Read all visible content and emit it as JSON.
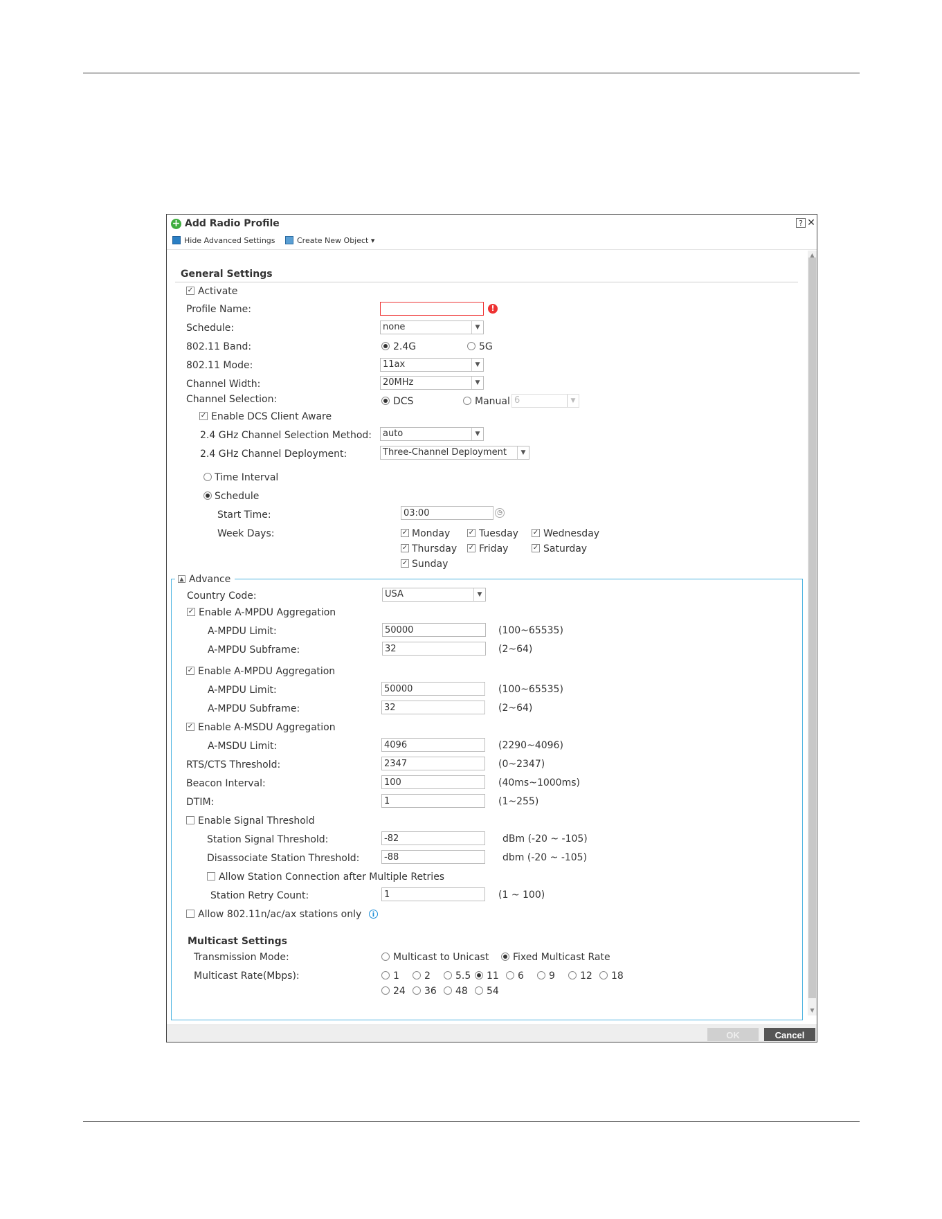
{
  "dialog": {
    "title": "Add Radio Profile",
    "help": "?",
    "close": "✕",
    "toolbar": {
      "hide_advanced": "Hide Advanced Settings",
      "create_object": "Create New Object ▾"
    },
    "ok_label": "OK",
    "cancel_label": "Cancel"
  },
  "general": {
    "heading": "General Settings",
    "activate": {
      "label": "Activate",
      "checked": true
    },
    "profile_name": {
      "label": "Profile Name:",
      "value": ""
    },
    "schedule": {
      "label": "Schedule:",
      "value": "none"
    },
    "band": {
      "label": "802.11 Band:",
      "opt1": "2.4G",
      "opt2": "5G",
      "selected": "2.4G"
    },
    "mode": {
      "label": "802.11 Mode:",
      "value": "11ax"
    },
    "channel_width": {
      "label": "Channel Width:",
      "value": "20MHz"
    },
    "channel_selection": {
      "label": "Channel Selection:",
      "opt1": "DCS",
      "opt2": "Manual",
      "manual_value": "6",
      "selected": "DCS"
    },
    "dcs_client_aware": {
      "label": "Enable DCS Client Aware",
      "checked": true
    },
    "selection_method": {
      "label": "2.4 GHz Channel Selection Method:",
      "value": "auto"
    },
    "deployment": {
      "label": "2.4 GHz Channel Deployment:",
      "value": "Three-Channel Deployment"
    },
    "time_interval": {
      "label": "Time Interval"
    },
    "schedule_radio": {
      "label": "Schedule"
    },
    "start_time": {
      "label": "Start Time:",
      "value": "03:00"
    },
    "week_days": {
      "label": "Week Days:",
      "days": [
        "Monday",
        "Tuesday",
        "Wednesday",
        "Thursday",
        "Friday",
        "Saturday",
        "Sunday"
      ]
    }
  },
  "advance": {
    "legend": "Advance",
    "country_code": {
      "label": "Country Code:",
      "value": "USA"
    },
    "ampdu1": {
      "label": "Enable A-MPDU Aggregation",
      "limit_label": "A-MPDU Limit:",
      "limit_value": "50000",
      "limit_range": "(100~65535)",
      "subframe_label": "A-MPDU Subframe:",
      "subframe_value": "32",
      "subframe_range": "(2~64)"
    },
    "ampdu2": {
      "label": "Enable A-MPDU Aggregation",
      "limit_label": "A-MPDU Limit:",
      "limit_value": "50000",
      "limit_range": "(100~65535)",
      "subframe_label": "A-MPDU Subframe:",
      "subframe_value": "32",
      "subframe_range": "(2~64)"
    },
    "amsdu": {
      "label": "Enable A-MSDU Aggregation",
      "limit_label": "A-MSDU Limit:",
      "limit_value": "4096",
      "limit_range": "(2290~4096)"
    },
    "rts": {
      "label": "RTS/CTS Threshold:",
      "value": "2347",
      "range": "(0~2347)"
    },
    "beacon": {
      "label": "Beacon Interval:",
      "value": "100",
      "range": "(40ms~1000ms)"
    },
    "dtim": {
      "label": "DTIM:",
      "value": "1",
      "range": "(1~255)"
    },
    "signal": {
      "label": "Enable Signal Threshold",
      "station_label": "Station Signal Threshold:",
      "station_value": "-82",
      "station_range": "dBm (-20 ~ -105)",
      "disassoc_label": "Disassociate Station Threshold:",
      "disassoc_value": "-88",
      "disassoc_range": "dbm (-20 ~ -105)",
      "allow_retries": "Allow Station Connection after Multiple Retries",
      "retry_label": "Station Retry Count:",
      "retry_value": "1",
      "retry_range": "(1 ~ 100)"
    },
    "allow_n_only": {
      "label": "Allow 802.11n/ac/ax stations only"
    },
    "multicast": {
      "heading": "Multicast Settings",
      "mode_label": "Transmission Mode:",
      "mode_opt1": "Multicast to Unicast",
      "mode_opt2": "Fixed Multicast Rate",
      "rate_label": "Multicast Rate(Mbps):",
      "rates": [
        "1",
        "2",
        "5.5",
        "11",
        "6",
        "9",
        "12",
        "18",
        "24",
        "36",
        "48",
        "54"
      ],
      "selected_rate": "11"
    }
  }
}
